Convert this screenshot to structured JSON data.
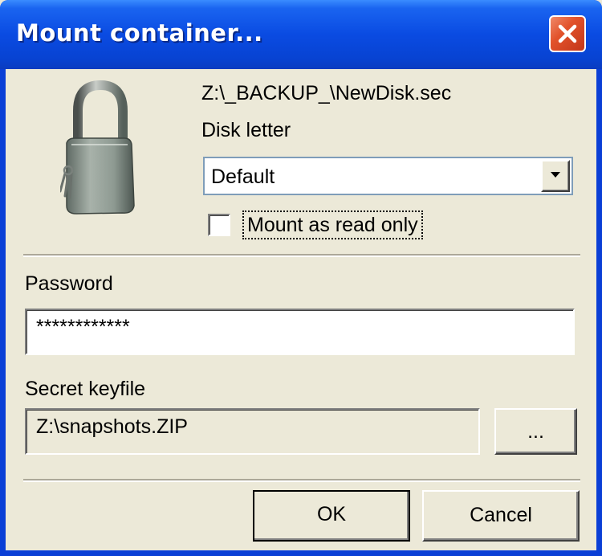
{
  "window": {
    "title": "Mount container..."
  },
  "container": {
    "file_path": "Z:\\_BACKUP_\\NewDisk.sec",
    "icon": "padlock-icon"
  },
  "disk_letter": {
    "label": "Disk letter",
    "selected": "Default"
  },
  "read_only": {
    "label": "Mount as read only",
    "checked": false
  },
  "password": {
    "label": "Password",
    "value": "************"
  },
  "keyfile": {
    "label": "Secret keyfile",
    "value": "Z:\\snapshots.ZIP",
    "browse_label": "..."
  },
  "buttons": {
    "ok": "OK",
    "cancel": "Cancel"
  },
  "colors": {
    "titlebar": "#0a4be2",
    "dialog_bg": "#ece9d8",
    "close_button": "#e2522b"
  }
}
